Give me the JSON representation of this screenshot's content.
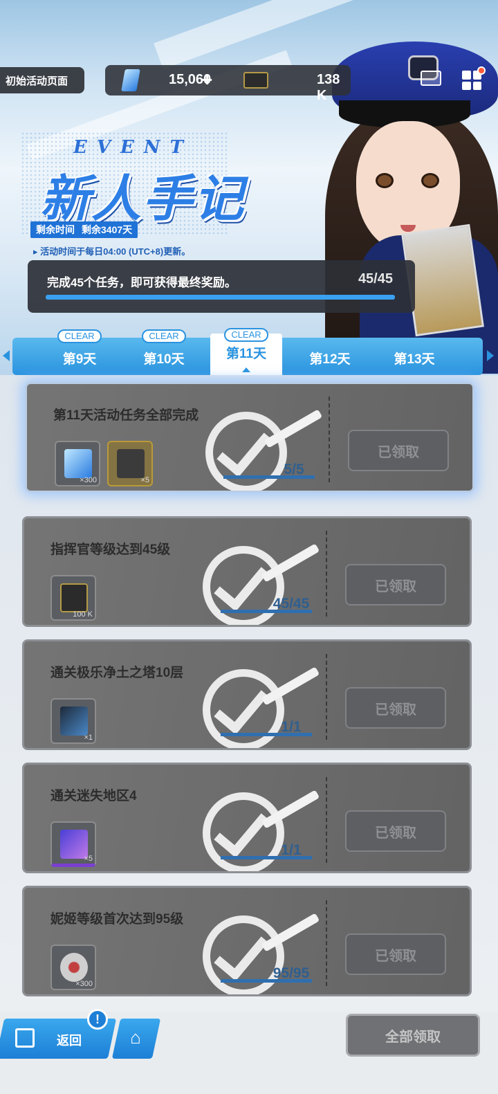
{
  "header": {
    "event_page_button": "初始活动页面",
    "currency_gem": "15,060",
    "currency_plus": "+",
    "currency_credit": "138 K"
  },
  "event": {
    "subtitle_en": "EVENT",
    "title": "新人手记",
    "time_label": "剩余时间",
    "time_value": "剩余3407天",
    "update_note": "活动时间于每日04:00 (UTC+8)更新。",
    "mission_text": "完成45个任务，即可获得最终奖励。",
    "mission_count": "45/45",
    "mission_progress_ratio": 1.0
  },
  "tabs": [
    {
      "label": "第9天",
      "clear": "CLEAR"
    },
    {
      "label": "第10天",
      "clear": "CLEAR"
    },
    {
      "label": "第11天",
      "clear": "CLEAR",
      "active": true
    },
    {
      "label": "第12天",
      "clear": ""
    },
    {
      "label": "第13天",
      "clear": ""
    }
  ],
  "tasks": [
    {
      "title": "第11天活动任务全部完成",
      "progress": "5/5",
      "button": "已领取",
      "rewards": [
        "×300",
        "×5"
      ]
    },
    {
      "title": "指挥官等级达到45级",
      "progress": "45/45",
      "button": "已领取",
      "rewards": [
        "100 K"
      ]
    },
    {
      "title": "通关极乐净土之塔10层",
      "progress": "1/1",
      "button": "已领取",
      "rewards": [
        "×1"
      ]
    },
    {
      "title": "通关迷失地区4",
      "progress": "1/1",
      "button": "已领取",
      "rewards": [
        "×5"
      ]
    },
    {
      "title": "妮姬等级首次达到95级",
      "progress": "95/95",
      "button": "已领取",
      "rewards": [
        "×300"
      ]
    }
  ],
  "footer": {
    "back_label": "返回",
    "notice_badge": "!",
    "claim_all": "全部领取"
  },
  "icons": {
    "gem": "blue-crystal-icon",
    "credit": "credit-ticket-icon",
    "mail": "mail-icon",
    "menu": "grid-menu-icon",
    "back": "exit-door-icon",
    "home": "home-icon",
    "stamp": "check-stamp-icon"
  },
  "colors": {
    "accent": "#2a93df",
    "card": "#6c6c6c",
    "dark_panel": "#2d3037"
  }
}
